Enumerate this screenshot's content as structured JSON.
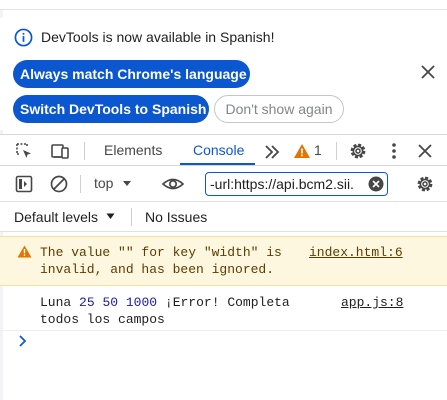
{
  "infobar": {
    "message": "DevTools is now available in Spanish!",
    "match_button": "Always match Chrome's language",
    "switch_button": "Switch DevTools to Spanish",
    "dont_show_button": "Don't show again"
  },
  "tabs": {
    "elements": "Elements",
    "console": "Console",
    "warning_count": "1"
  },
  "filter": {
    "context": "top",
    "filter_value": "-url:https://api.bcm2.sii."
  },
  "levels": {
    "default_levels": "Default levels",
    "issues": "No Issues"
  },
  "messages": [
    {
      "level": "warning",
      "text_line1": "The value \"\" for key \"width\" is",
      "text_line2": "invalid, and has been ignored.",
      "source": "index.html:6"
    },
    {
      "level": "log",
      "prefix": "Luna",
      "num1": "25",
      "num2": "50",
      "num3": "1000",
      "suffix": "¡Error! Completa",
      "line2": "todos los campos",
      "source": "app.js:8"
    }
  ],
  "colors": {
    "accent": "#0b57d0",
    "warning_bg": "#fef7e0",
    "warning_icon": "#e37400"
  }
}
